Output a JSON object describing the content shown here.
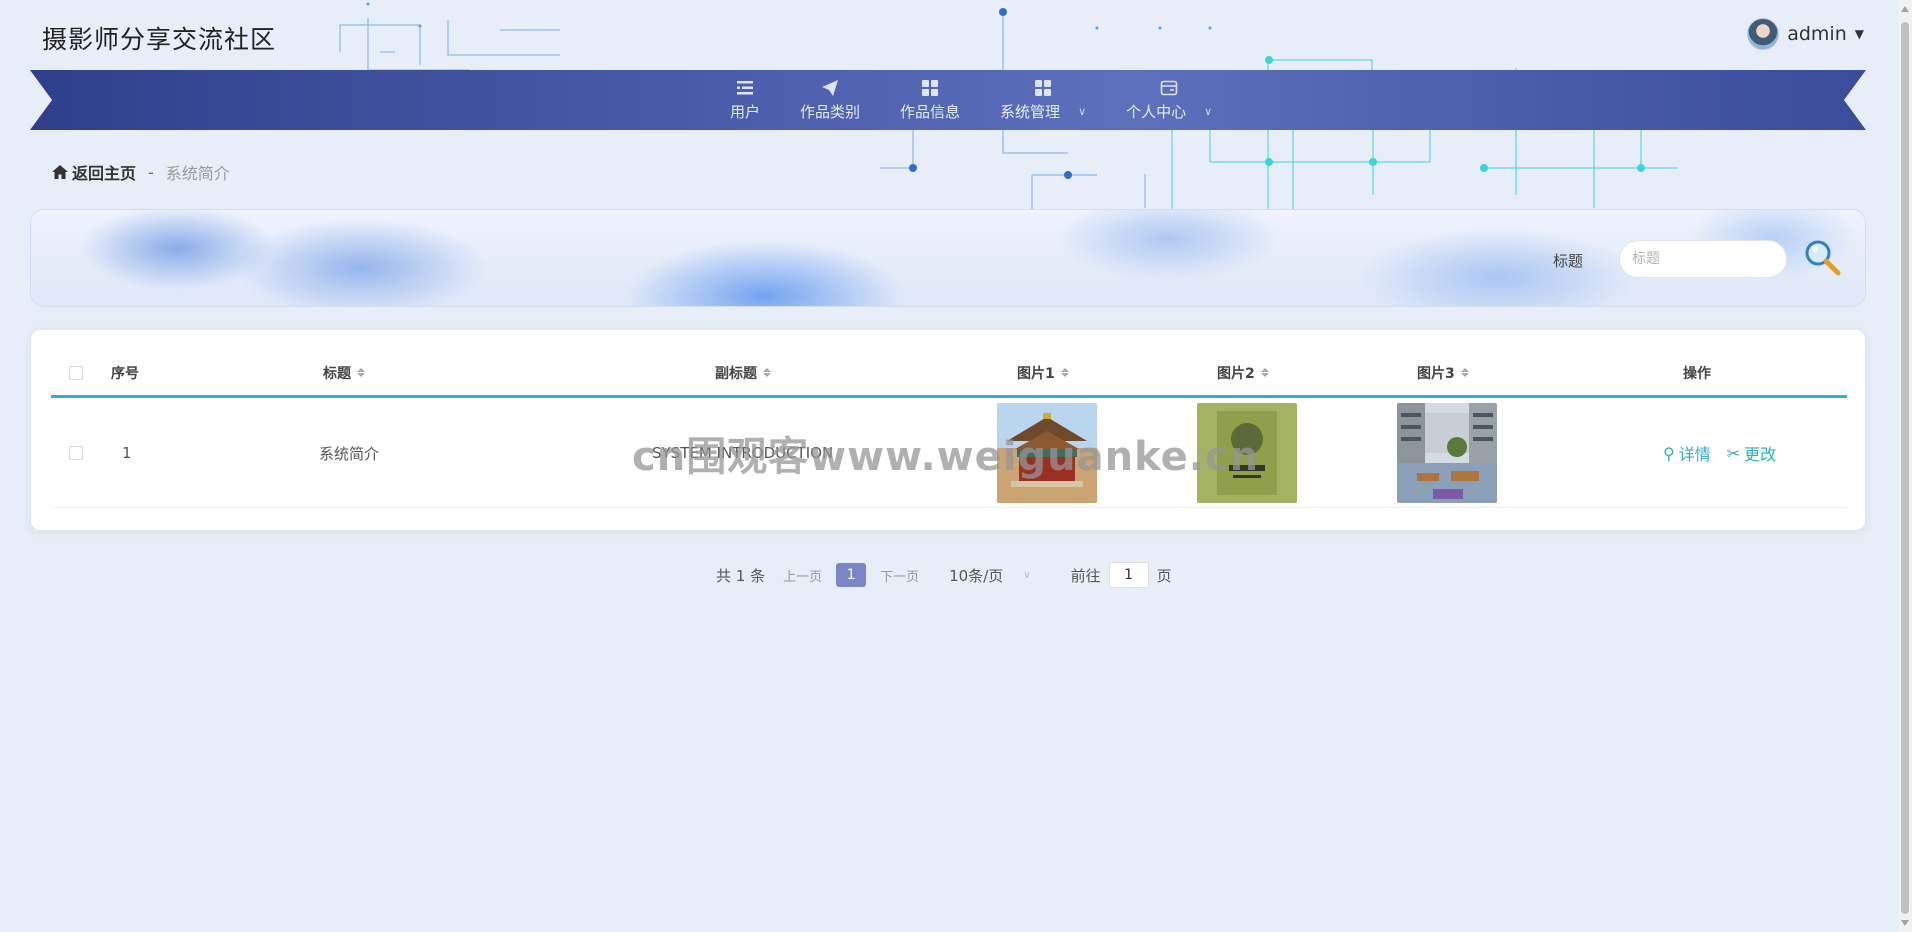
{
  "header": {
    "site_title": "摄影师分享交流社区",
    "user_name": "admin"
  },
  "nav": {
    "items": [
      {
        "label": "用户",
        "icon": "list-icon",
        "has_dropdown": false
      },
      {
        "label": "作品类别",
        "icon": "send-icon",
        "has_dropdown": false
      },
      {
        "label": "作品信息",
        "icon": "grid-icon",
        "has_dropdown": false
      },
      {
        "label": "系统管理",
        "icon": "grid-icon",
        "has_dropdown": true
      },
      {
        "label": "个人中心",
        "icon": "wallet-icon",
        "has_dropdown": true
      }
    ]
  },
  "breadcrumb": {
    "home": "返回主页",
    "separator": "-",
    "current": "系统简介"
  },
  "search": {
    "label": "标题",
    "placeholder": "标题",
    "value": ""
  },
  "table": {
    "headers": {
      "index": "序号",
      "title": "标题",
      "subtitle": "副标题",
      "pic1": "图片1",
      "pic2": "图片2",
      "pic3": "图片3",
      "actions": "操作"
    },
    "rows": [
      {
        "index": "1",
        "title": "系统简介",
        "subtitle": "SYSTEM INTRODUCTION",
        "pic1": "temple-photo",
        "pic2": "book-cover-photo",
        "pic3": "building-courtyard-photo",
        "detail_label": "详情",
        "edit_label": "更改"
      }
    ]
  },
  "pagination": {
    "total_text": "共 1 条",
    "prev_label": "上一页",
    "current_page": "1",
    "next_label": "下一页",
    "page_size_label": "10条/页",
    "goto_label": "前往",
    "goto_value": "1",
    "page_unit": "页"
  },
  "watermark": "cn围观客www.weiguanke.cn",
  "colors": {
    "nav_bg": "#4a5aa8",
    "accent": "#2ab0dd",
    "action": "#2ab0c9",
    "page_active": "#7c86c6",
    "body_bg": "#e7eef7"
  }
}
